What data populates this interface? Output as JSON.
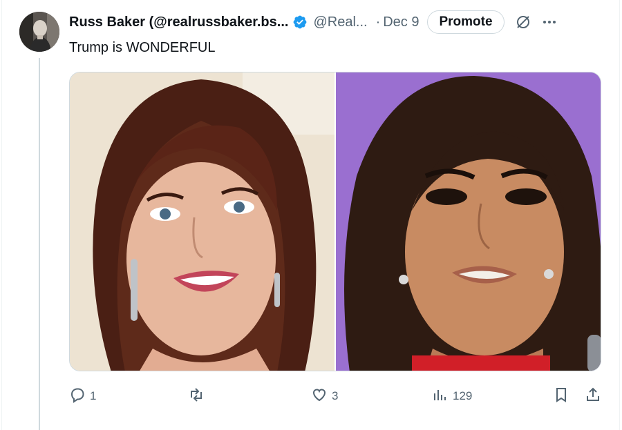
{
  "tweet": {
    "display_name": "Russ Baker (@realrussbaker.bs...",
    "handle": "@Real...",
    "separator": "·",
    "timestamp": "Dec 9",
    "promote_label": "Promote",
    "text": "Trump is WONDERFUL",
    "verified_color": "#1d9bf0"
  },
  "media": {
    "photos": [
      {
        "icon": "photo-woman-smiling"
      },
      {
        "icon": "photo-woman-purple-background"
      }
    ]
  },
  "actions": {
    "reply_count": "1",
    "retweet_count": "",
    "like_count": "3",
    "views_count": "129"
  },
  "icons": {
    "verified": "verified-badge-icon",
    "grok": "grok-icon",
    "more": "more-icon",
    "reply": "reply-icon",
    "retweet": "retweet-icon",
    "like": "heart-icon",
    "views": "views-icon",
    "bookmark": "bookmark-icon",
    "share": "share-icon"
  }
}
